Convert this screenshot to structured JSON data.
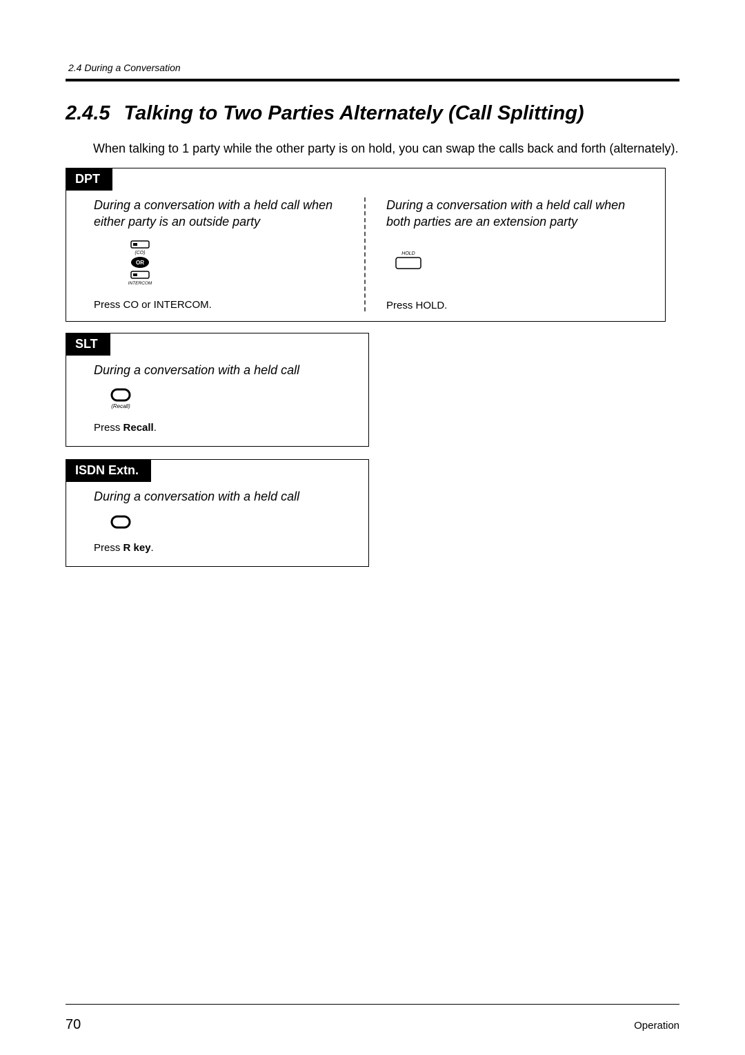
{
  "header": {
    "running_head": "2.4   During a Conversation"
  },
  "section": {
    "number": "2.4.5",
    "title": "Talking to Two Parties Alternately (Call Splitting)",
    "intro": "When talking to 1 party while the other party is on hold, you can swap the calls back and forth (alternately)."
  },
  "dpt": {
    "tab": "DPT",
    "left": {
      "scenario": "During a conversation with a held call when either party is an outside party",
      "icon_co": "(CO)",
      "icon_or": "OR",
      "icon_intercom": "INTERCOM",
      "instruction": "Press CO or INTERCOM."
    },
    "right": {
      "scenario": "During a conversation with a held call when both parties are an extension party",
      "icon_hold": "HOLD",
      "instruction": "Press HOLD."
    }
  },
  "slt": {
    "tab": "SLT",
    "scenario": "During a conversation with a held call",
    "icon_label": "(Recall)",
    "instruction_prefix": "Press ",
    "instruction_bold": "Recall",
    "instruction_suffix": "."
  },
  "isdn": {
    "tab": "ISDN Extn.",
    "scenario": "During a conversation with a held call",
    "instruction_prefix": "Press ",
    "instruction_bold": "R key",
    "instruction_suffix": "."
  },
  "footer": {
    "page": "70",
    "label": "Operation"
  }
}
